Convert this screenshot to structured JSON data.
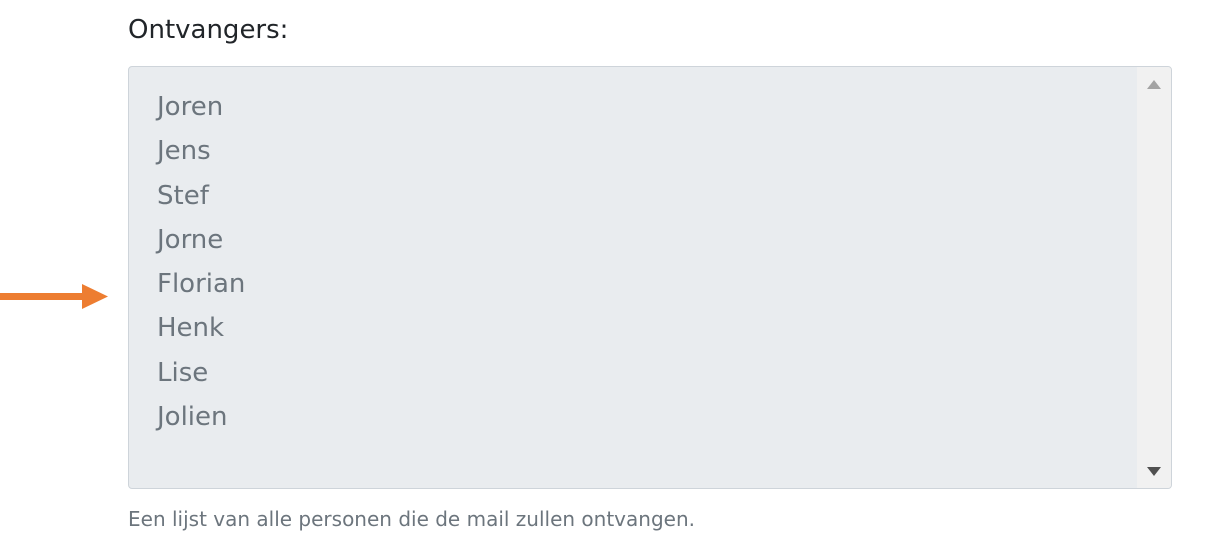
{
  "form": {
    "label": "Ontvangers:",
    "help_text": "Een lijst van alle personen die de mail zullen ontvangen.",
    "recipients": [
      "Joren",
      "Jens",
      "Stef",
      "Jorne",
      "Florian",
      "Henk",
      "Lise",
      "Jolien"
    ]
  },
  "annotation": {
    "arrow_icon": "arrow-right-icon",
    "arrow_color": "#ed7d31"
  },
  "colors": {
    "listbox_background": "#e9ecef",
    "listbox_border": "#ced4da",
    "option_text": "#6c757d",
    "label_text": "#212529"
  }
}
